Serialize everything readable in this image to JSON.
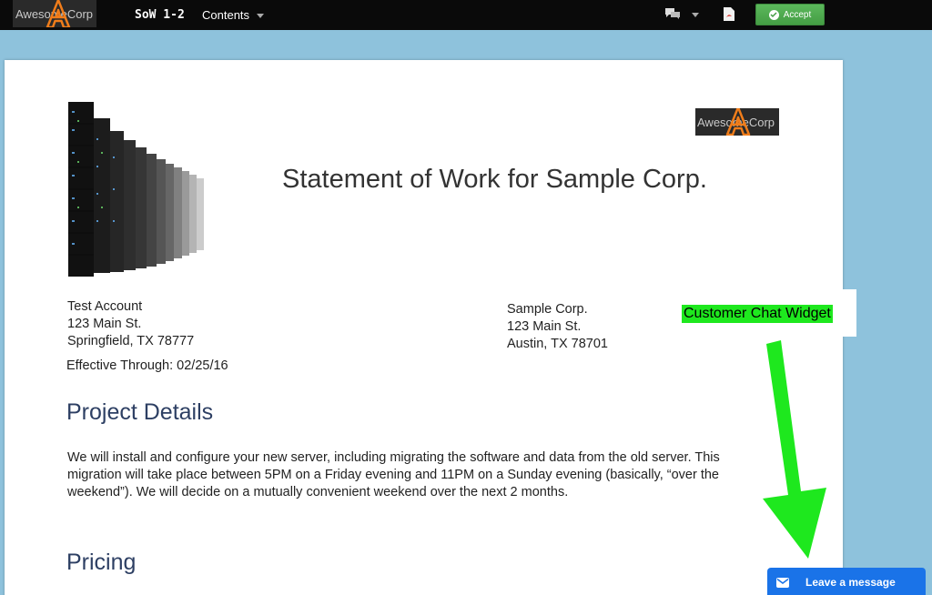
{
  "topbar": {
    "logo_text": "AwesomeCorp",
    "doc_title": "SoW 1-2",
    "contents_label": "Contents",
    "accept_label": "Accept"
  },
  "document": {
    "logo_text": "AwesomeCorp",
    "title": "Statement of Work for Sample Corp.",
    "from_address": {
      "line1": "Test Account",
      "line2": "123 Main St.",
      "line3": "Springfield, TX 78777"
    },
    "to_address": {
      "line1": "Sample Corp.",
      "line2": "123 Main St.",
      "line3": "Austin, TX 78701"
    },
    "effective_label": "Effective Through:",
    "effective_date": "02/25/16",
    "project_heading": "Project Details",
    "project_text": "We will install and configure your new server, including migrating the software and data from the old server. This migration will take place between 5PM on a Friday evening and 11PM on a Sunday evening (basically, “over the weekend”). We will decide on a mutually convenient weekend over the next 2 months.",
    "pricing_heading": "Pricing"
  },
  "annotation": {
    "label": "Customer Chat Widget",
    "color": "#1ee81e"
  },
  "chat": {
    "leave_message_label": "Leave a message",
    "color": "#1a73e8"
  },
  "icons": [
    "awesomecorp-logo-icon",
    "comments-icon",
    "pdf-icon",
    "check-icon",
    "server-rack-image",
    "envelope-icon",
    "arrow-down-icon"
  ]
}
